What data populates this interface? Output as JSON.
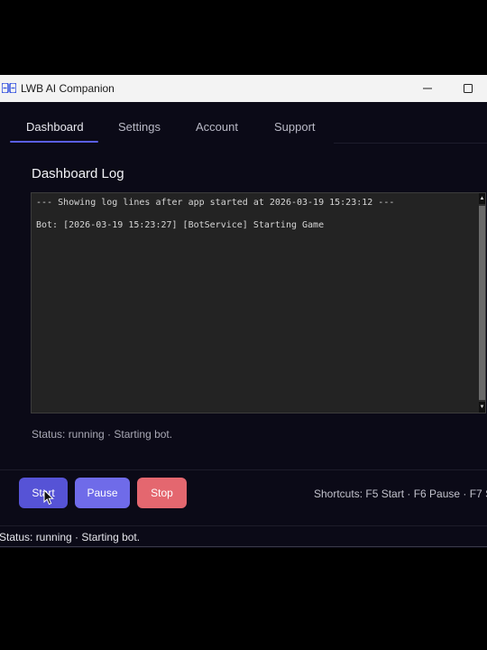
{
  "window": {
    "title": "LWB AI Companion",
    "logo_text": "ΞB"
  },
  "tabs": [
    {
      "label": "Dashboard",
      "active": true
    },
    {
      "label": "Settings",
      "active": false
    },
    {
      "label": "Account",
      "active": false
    },
    {
      "label": "Support",
      "active": false
    }
  ],
  "dashboard": {
    "section_title": "Dashboard Log",
    "log_lines": [
      "--- Showing log lines after app started at 2026-03-19 15:23:12 ---",
      "Bot: [2026-03-19 15:23:27] [BotService] Starting Game"
    ],
    "status_text": "Status: running · Starting bot."
  },
  "controls": {
    "start_label": "Start",
    "pause_label": "Pause",
    "stop_label": "Stop",
    "shortcuts_text": "Shortcuts: F5 Start · F6 Pause · F7 S"
  },
  "statusbar": {
    "text": "Status: running · Starting bot."
  },
  "colors": {
    "accent": "#5a5ee6",
    "start_button": "#5653d6",
    "pause_button": "#6f6be9",
    "stop_button": "#e4676f",
    "background": "#0b0a17"
  }
}
